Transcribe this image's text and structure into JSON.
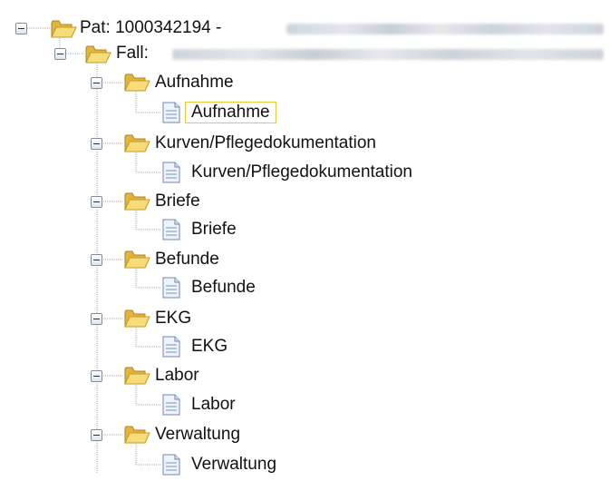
{
  "tree": {
    "patient": {
      "label": "Pat: 1000342194 -"
    },
    "fall": {
      "label": "Fall:"
    },
    "groups": [
      {
        "label": "Aufnahme",
        "child": "Aufnahme"
      },
      {
        "label": "Kurven/Pflegedokumentation",
        "child": "Kurven/Pflegedokumentation"
      },
      {
        "label": "Briefe",
        "child": "Briefe"
      },
      {
        "label": "Befunde",
        "child": "Befunde"
      },
      {
        "label": "EKG",
        "child": "EKG"
      },
      {
        "label": "Labor",
        "child": "Labor"
      },
      {
        "label": "Verwaltung",
        "child": "Verwaltung"
      }
    ],
    "selected": "Aufnahme",
    "icons": {
      "expander": "collapse-minus-icon",
      "folder": "open-folder-icon",
      "document": "document-icon"
    }
  }
}
